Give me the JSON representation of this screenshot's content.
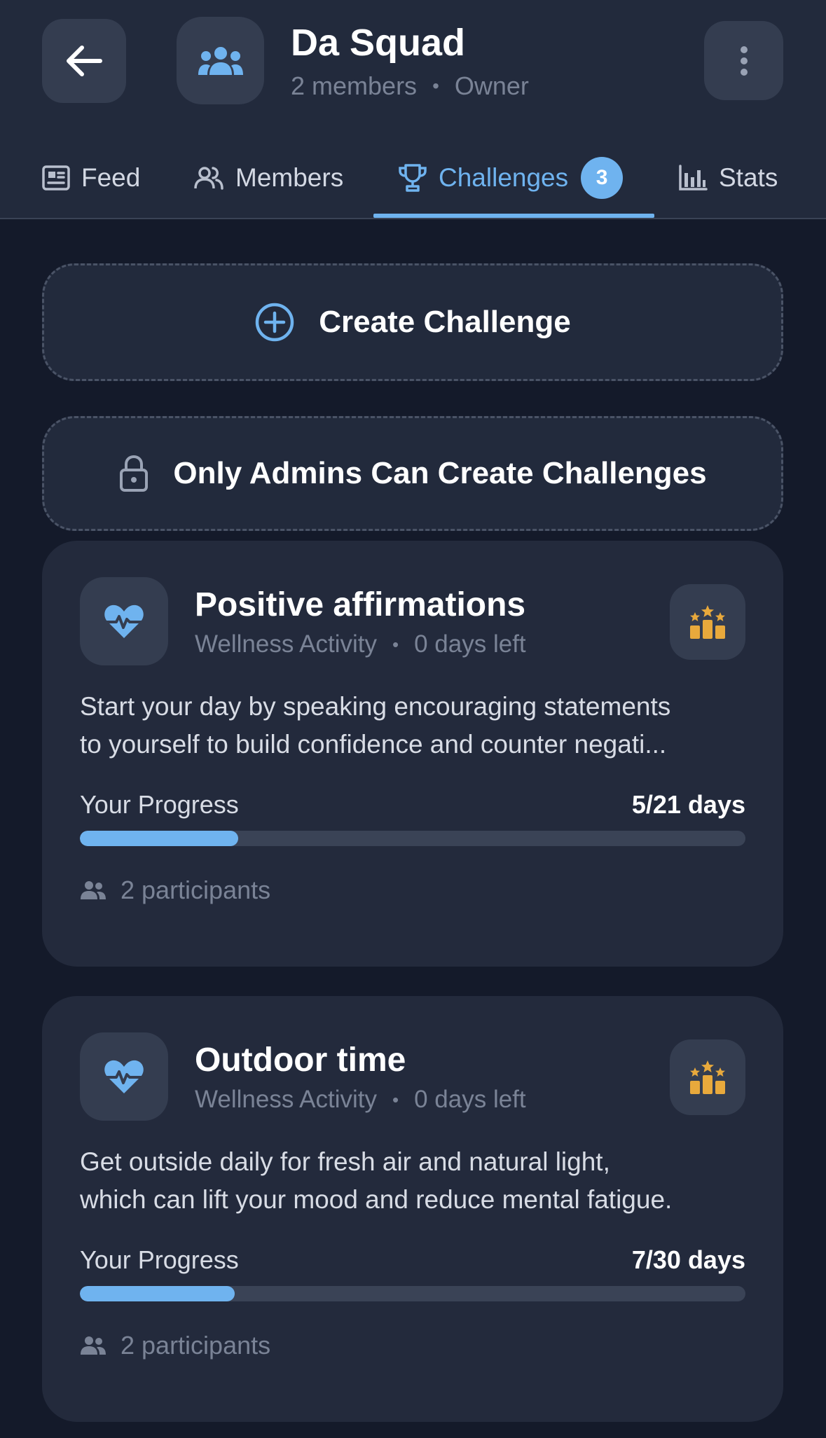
{
  "header": {
    "group_name": "Da Squad",
    "members_count": "2 members",
    "role": "Owner",
    "separator": "•"
  },
  "tabs": [
    {
      "label": "Feed",
      "icon": "newspaper-icon",
      "active": false
    },
    {
      "label": "Members",
      "icon": "people-icon",
      "active": false
    },
    {
      "label": "Challenges",
      "icon": "trophy-icon",
      "active": true,
      "badge": "3"
    },
    {
      "label": "Stats",
      "icon": "bar-chart-icon",
      "active": false
    }
  ],
  "actions": {
    "create_label": "Create Challenge",
    "admins_only_label": "Only Admins Can Create Challenges"
  },
  "challenges": [
    {
      "title": "Positive affirmations",
      "category": "Wellness Activity",
      "days_left": "0 days left",
      "description_line1": "Start your day by speaking encouraging statements",
      "description_line2": "to yourself to build confidence and counter negati...",
      "progress_label": "Your Progress",
      "progress_value": "5/21 days",
      "progress_fraction": 0.238,
      "participants": "2 participants"
    },
    {
      "title": "Outdoor time",
      "category": "Wellness Activity",
      "days_left": "0 days left",
      "description_line1": "Get outside daily for fresh air and natural light,",
      "description_line2": "which can lift your mood and reduce mental fatigue.",
      "progress_label": "Your Progress",
      "progress_value": "7/30 days",
      "progress_fraction": 0.233,
      "participants": "2 participants"
    }
  ],
  "colors": {
    "accent": "#6fb3ef",
    "background": "#141a2a",
    "card": "#232a3c",
    "gold": "#e8a93c"
  }
}
